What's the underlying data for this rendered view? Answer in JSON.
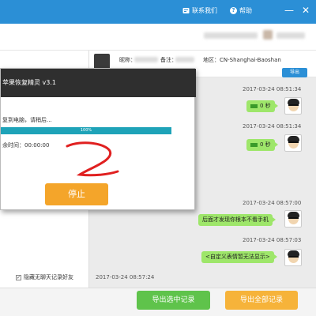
{
  "titlebar": {
    "contact_label": "联系我们",
    "help_label": "帮助",
    "help_icon_glyph": "?",
    "minimize_glyph": "—",
    "close_glyph": "✕",
    "color": "#2b8fd6"
  },
  "contact": {
    "nickname_label": "昵称：",
    "note_label": "备注：",
    "region_label": "地区：CN-Shanghai-Baoshan",
    "export_label": "导出"
  },
  "dialog": {
    "title": "苹果恢复精灵 v3.1",
    "status": "复到电脑，请稍后...",
    "progress_percent": 100,
    "progress_text": "100%",
    "time_remaining": "余时间：00:00:00",
    "stop_label": "停止"
  },
  "left_panel": {
    "hide_checkbox_label": "隐藏无聊天记录好友",
    "hide_checkbox_checked": true,
    "checkmark_glyph": "✓"
  },
  "chat": {
    "voice_duration_text": "0 秒",
    "messages": [
      {
        "time": "2017-03-24 08:51:34",
        "text": "0 秒",
        "type": "voice"
      },
      {
        "time": "2017-03-24 08:51:34",
        "text": "0 秒",
        "type": "voice"
      },
      {
        "time": "2017-03-24 08:57:00",
        "text": "后面才发现你根本不看手机",
        "type": "text"
      },
      {
        "time": "2017-03-24 08:57:03",
        "text": "<自定义表情暂无法显示>",
        "type": "text"
      }
    ],
    "bottom_time": "2017-03-24 08:57:24",
    "bubble_color": "#9ee66a"
  },
  "footer": {
    "export_selected_label": "导出选中记录",
    "export_all_label": "导出全部记录",
    "green": "#5fc34b",
    "orange": "#f6b33a"
  }
}
